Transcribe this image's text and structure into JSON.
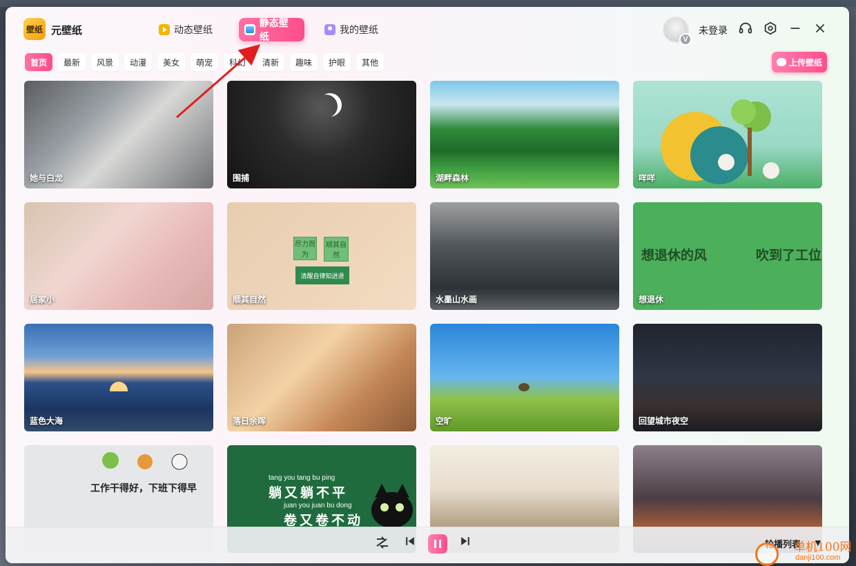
{
  "app": {
    "logo_text": "壁纸",
    "name": "元壁纸"
  },
  "top_tabs": [
    {
      "label": "动态壁纸",
      "active": false
    },
    {
      "label": "静态壁纸",
      "active": true
    },
    {
      "label": "我的壁纸",
      "active": false
    }
  ],
  "user": {
    "badge": "V",
    "login_label": "未登录"
  },
  "window_icons": [
    "headset-icon",
    "settings-icon",
    "minimize-icon",
    "close-icon"
  ],
  "categories": [
    "首页",
    "最新",
    "风景",
    "动漫",
    "美女",
    "萌宠",
    "科幻",
    "清新",
    "趣味",
    "护眼",
    "其他"
  ],
  "active_category": "首页",
  "upload_label": "上传壁纸",
  "wallpapers": [
    {
      "caption": "她与白龙"
    },
    {
      "caption": "围捕"
    },
    {
      "caption": "湖畔森林"
    },
    {
      "caption": "咩咩"
    },
    {
      "caption": "居家小"
    },
    {
      "caption": "顺其自然"
    },
    {
      "caption": "水墨山水画"
    },
    {
      "caption": "想退休"
    },
    {
      "caption": "蓝色大海"
    },
    {
      "caption": "落日余晖"
    },
    {
      "caption": "空旷"
    },
    {
      "caption": "回望城市夜空"
    },
    {
      "caption": ""
    },
    {
      "caption": ""
    },
    {
      "caption": ""
    },
    {
      "caption": ""
    }
  ],
  "card_texts": {
    "c6_note1": "尽力而为",
    "c6_note2": "顺其自然",
    "c6_main": "清醒自律知进退",
    "c8_left": "想退休的风",
    "c8_right": "吹到了工位",
    "c13_text": "工作干得好，下班下得早",
    "c14_py1": "tang you tang bu ping",
    "c14_hz1": "躺又躺不平",
    "c14_py2": "juan you juan bu dong",
    "c14_hz2": "卷又卷不动"
  },
  "player": {
    "carousel_label": "轮播列表"
  },
  "watermark": {
    "site": "单机100网",
    "url": "danji100.com"
  },
  "colors": {
    "accent": "#ff4d8c",
    "annotation_arrow": "#e11d1d"
  }
}
